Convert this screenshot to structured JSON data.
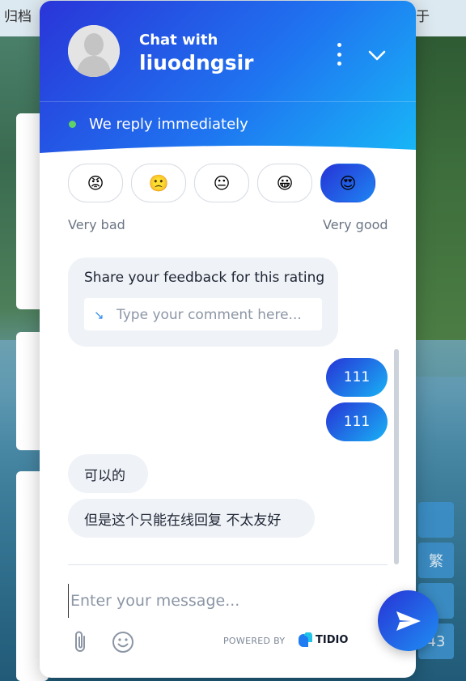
{
  "background": {
    "topbar_left": "归档",
    "topbar_right": "于",
    "side_buttons": [
      "",
      "繁",
      "",
      "43"
    ]
  },
  "header": {
    "chat_with": "Chat with",
    "agent_name": "liuodngsir",
    "status": "We reply immediately",
    "status_color": "#5fd167"
  },
  "rating": {
    "options": [
      {
        "emoji": "😡",
        "name": "very-bad"
      },
      {
        "emoji": "🙁",
        "name": "bad"
      },
      {
        "emoji": "😐",
        "name": "neutral"
      },
      {
        "emoji": "😀",
        "name": "good"
      },
      {
        "emoji": "😍",
        "name": "very-good"
      }
    ],
    "selected_index": 4,
    "low_label": "Very bad",
    "high_label": "Very good"
  },
  "feedback": {
    "title": "Share your feedback for this rating",
    "placeholder": "Type your comment here..."
  },
  "messages": {
    "outgoing": [
      "111",
      "111"
    ],
    "incoming": [
      "可以的",
      "但是这个只能在线回复 不太友好"
    ]
  },
  "composer": {
    "placeholder": "Enter your message...",
    "powered_by": "POWERED BY",
    "brand": "TIDIO"
  },
  "colors": {
    "accent_start": "#2733d6",
    "accent_end": "#18b2f5"
  }
}
